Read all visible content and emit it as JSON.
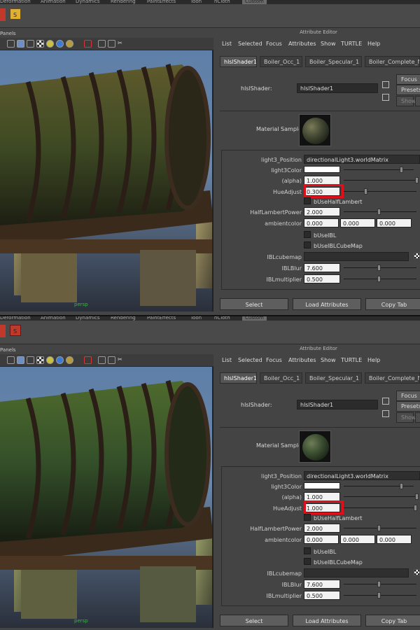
{
  "menubar": [
    "Deformation",
    "Animation",
    "Dynamics",
    "Rendering",
    "PaintEffects",
    "Toon",
    "nCloth",
    "Custom"
  ],
  "viewport": {
    "panels_label": "Panels",
    "camera_label": "persp"
  },
  "attribute_editor": {
    "title": "Attribute Editor",
    "menu": [
      "List",
      "Selected",
      "Focus",
      "Attributes",
      "Show",
      "TURTLE",
      "Help"
    ],
    "tabs": [
      "hlslShader1",
      "Boiler_Occ_1",
      "Boiler_Specular_1",
      "Boiler_Complete_Norr"
    ],
    "shader_label": "hlslShader:",
    "shader_value": "hlslShader1",
    "side_buttons": {
      "focus": "Focus",
      "presets": "Presets",
      "show": "Show",
      "hide": "H"
    },
    "material_sample_label": "Material Sample",
    "attrs": {
      "light3_position_label": "light3_Position",
      "light3_position_value": "directionalLight3.worldMatrix",
      "light3color_label": "light3Color",
      "alpha_label": "(alpha)",
      "alpha_value": "1.000",
      "hueadjust_label": "HueAdjust",
      "bUseHalfLambert_label": "bUseHalfLambert",
      "halflambertpower_label": "HalfLambertPower",
      "halflambertpower_value": "2.000",
      "ambientcolor_label": "ambientcolor",
      "ambientcolor_values": [
        "0.000",
        "0.000",
        "0.000"
      ],
      "bUseIBL_label": "bUseIBL",
      "bUseIBLCubeMap_label": "bUseIBLCubeMap",
      "iblcubemap_label": "IBLcubemap",
      "iblblur_label": "IBLBlur",
      "iblblur_value": "7.600",
      "iblmultiplier_label": "IBLmultiplier",
      "iblmultiplier_value": "0.500"
    },
    "bottom_buttons": [
      "Select",
      "Load Attributes",
      "Copy Tab"
    ]
  },
  "panels": [
    {
      "hueadjust_value": "0.300",
      "hueadjust_level": 0.3
    },
    {
      "hueadjust_value": "1.000",
      "hueadjust_level": 1.0
    }
  ],
  "colors": {
    "highlight": "#e0101a",
    "persp_label": "#3cb34a",
    "background": "#444444"
  }
}
